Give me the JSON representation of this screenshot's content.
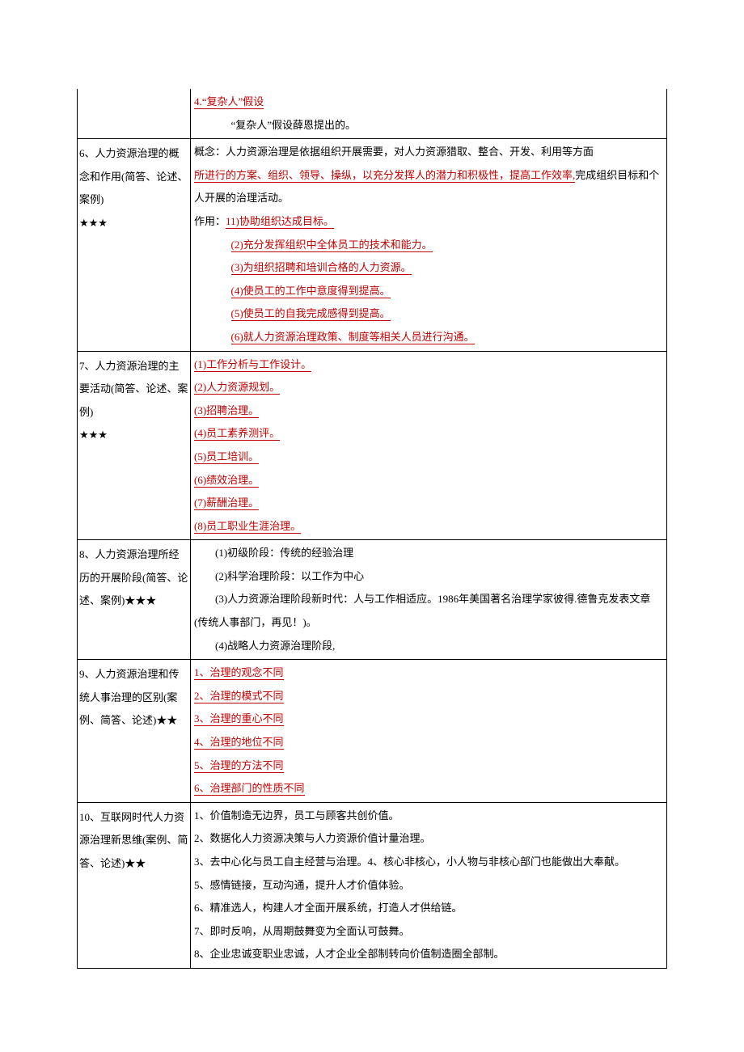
{
  "rows": [
    {
      "left": "",
      "right_lines": [
        {
          "indent": false,
          "text": "4.“复杂人”假设",
          "red": true,
          "underline": true
        },
        {
          "indent": "indent",
          "text": "“复杂人”假设薛恩提出的。",
          "red": false,
          "underline": false
        }
      ]
    },
    {
      "left": "6、人力资源治理的概念和作用(简答、论述、案例)",
      "stars": "★★★",
      "right_lines": [
        {
          "indent": false,
          "parts": [
            {
              "text": "概念：人力资源治理是依据组织开展需要，对人力资源猎取、整合、开发、利用等方",
              "red": false,
              "underline": false
            },
            {
              "text": "面",
              "red": false,
              "underline": false
            }
          ]
        },
        {
          "indent": false,
          "parts": [
            {
              "text": "所进行的方案、组织、领导、操纵，以充分发挥人的潜力和积极性，提高工作效率,",
              "red": true,
              "underline": true
            },
            {
              "text": "完成组织目标和个人开展的治理活动。",
              "red": false,
              "underline": false
            }
          ],
          "wrap": true
        },
        {
          "indent": false,
          "parts": [
            {
              "text": "作用：",
              "red": false,
              "underline": false
            },
            {
              "text": "11)协助组织达成目标。",
              "red": true,
              "underline": true
            }
          ]
        },
        {
          "indent": "indent",
          "text": "(2)充分发挥组织中全体员工的技术和能力。",
          "red": true,
          "underline": true
        },
        {
          "indent": "indent",
          "text": "(3)为组织招聘和培训合格的人力资源。",
          "red": true,
          "underline": true
        },
        {
          "indent": "indent",
          "text": "(4)使员工的工作中意度得到提高。",
          "red": true,
          "underline": true
        },
        {
          "indent": "indent",
          "text": "(5)使员工的自我完成感得到提高。",
          "red": true,
          "underline": true
        },
        {
          "indent": "indent",
          "text": "(6)就人力资源治理政策、制度等相关人员进行沟通。",
          "red": true,
          "underline": true
        }
      ]
    },
    {
      "left": "7、人力资源治理的主要活动(简答、论述、案例)",
      "stars": "★★★",
      "right_lines": [
        {
          "indent": false,
          "text": "(1)工作分析与工作设计。",
          "red": true,
          "underline": true
        },
        {
          "indent": false,
          "text": "(2)人力资源规划。",
          "red": true,
          "underline": true
        },
        {
          "indent": false,
          "text": "(3)招聘治理。",
          "red": true,
          "underline": true
        },
        {
          "indent": false,
          "text": "(4)员工素养测评。",
          "red": true,
          "underline": true
        },
        {
          "indent": false,
          "text": "(5)员工培训。",
          "red": true,
          "underline": true
        },
        {
          "indent": false,
          "text": "(6)绩效治理。",
          "red": true,
          "underline": true
        },
        {
          "indent": false,
          "text": "(7)薪酬治理。",
          "red": true,
          "underline": true
        },
        {
          "indent": false,
          "text": "(8)员工职业生涯治理。",
          "red": true,
          "underline": true
        }
      ]
    },
    {
      "left": "8、人力资源治理所经历的开展阶段(简答、论述、案例)★★★",
      "right_lines": [
        {
          "indent": "indent-small",
          "text": "(1)初级阶段：传统的经验治理",
          "red": false,
          "underline": false
        },
        {
          "indent": "indent-small",
          "text": "(2)科学治理阶段：以工作为中心",
          "red": false,
          "underline": false
        },
        {
          "indent": "indent-small",
          "text": "(3)人力资源治理阶段新时代：人与工作相适应。1986年美国著名治理学家彼得.德鲁克发表文章",
          "red": false,
          "underline": false
        },
        {
          "indent": false,
          "text": "(传统人事部门，再见！)。",
          "red": false,
          "underline": false
        },
        {
          "indent": "indent-small",
          "text": "(4)战略人力资源治理阶段,",
          "red": false,
          "underline": false
        }
      ]
    },
    {
      "left": "9、人力资源治理和传统人事治理的区别(案例、简答、论述)★★",
      "right_lines": [
        {
          "indent": false,
          "text": "1、治理的观念不同",
          "red": true,
          "underline": true
        },
        {
          "indent": false,
          "text": "2、治理的模式不同",
          "red": true,
          "underline": true
        },
        {
          "indent": false,
          "text": "3、治理的重心不同",
          "red": true,
          "underline": true
        },
        {
          "indent": false,
          "text": "4、治理的地位不同",
          "red": true,
          "underline": true
        },
        {
          "indent": false,
          "text": "5、治理的方法不同",
          "red": true,
          "underline": true
        },
        {
          "indent": false,
          "text": "6、治理部门的性质不同",
          "red": true,
          "underline": true
        }
      ]
    },
    {
      "left": "10、互联网时代人力资源治理新思维(案例、简答、论述)★★",
      "right_lines": [
        {
          "indent": false,
          "text": "1、价值制造无边界，员工与顾客共创价值。",
          "red": false,
          "underline": false
        },
        {
          "indent": false,
          "text": "2、数据化人力资源决策与人力资源价值计量治理。",
          "red": false,
          "underline": false
        },
        {
          "indent": false,
          "text": "3、去中心化与员工自主经营与治理。4、核心非核心，小人物与非核心部门也能做出大奉献。",
          "red": false,
          "underline": false
        },
        {
          "indent": false,
          "text": "5、感情链接，互动沟通，提升人才价值体验。",
          "red": false,
          "underline": false
        },
        {
          "indent": false,
          "text": "6、精准选人，构建人才全面开展系统，打造人才供给链。",
          "red": false,
          "underline": false
        },
        {
          "indent": false,
          "text": "7、即时反响，从周期鼓舞变为全面认可鼓舞。",
          "red": false,
          "underline": false
        },
        {
          "indent": false,
          "text": "8、企业忠诚变职业忠诚，人才企业全部制转向价值制造圈全部制。",
          "red": false,
          "underline": false
        }
      ]
    }
  ]
}
